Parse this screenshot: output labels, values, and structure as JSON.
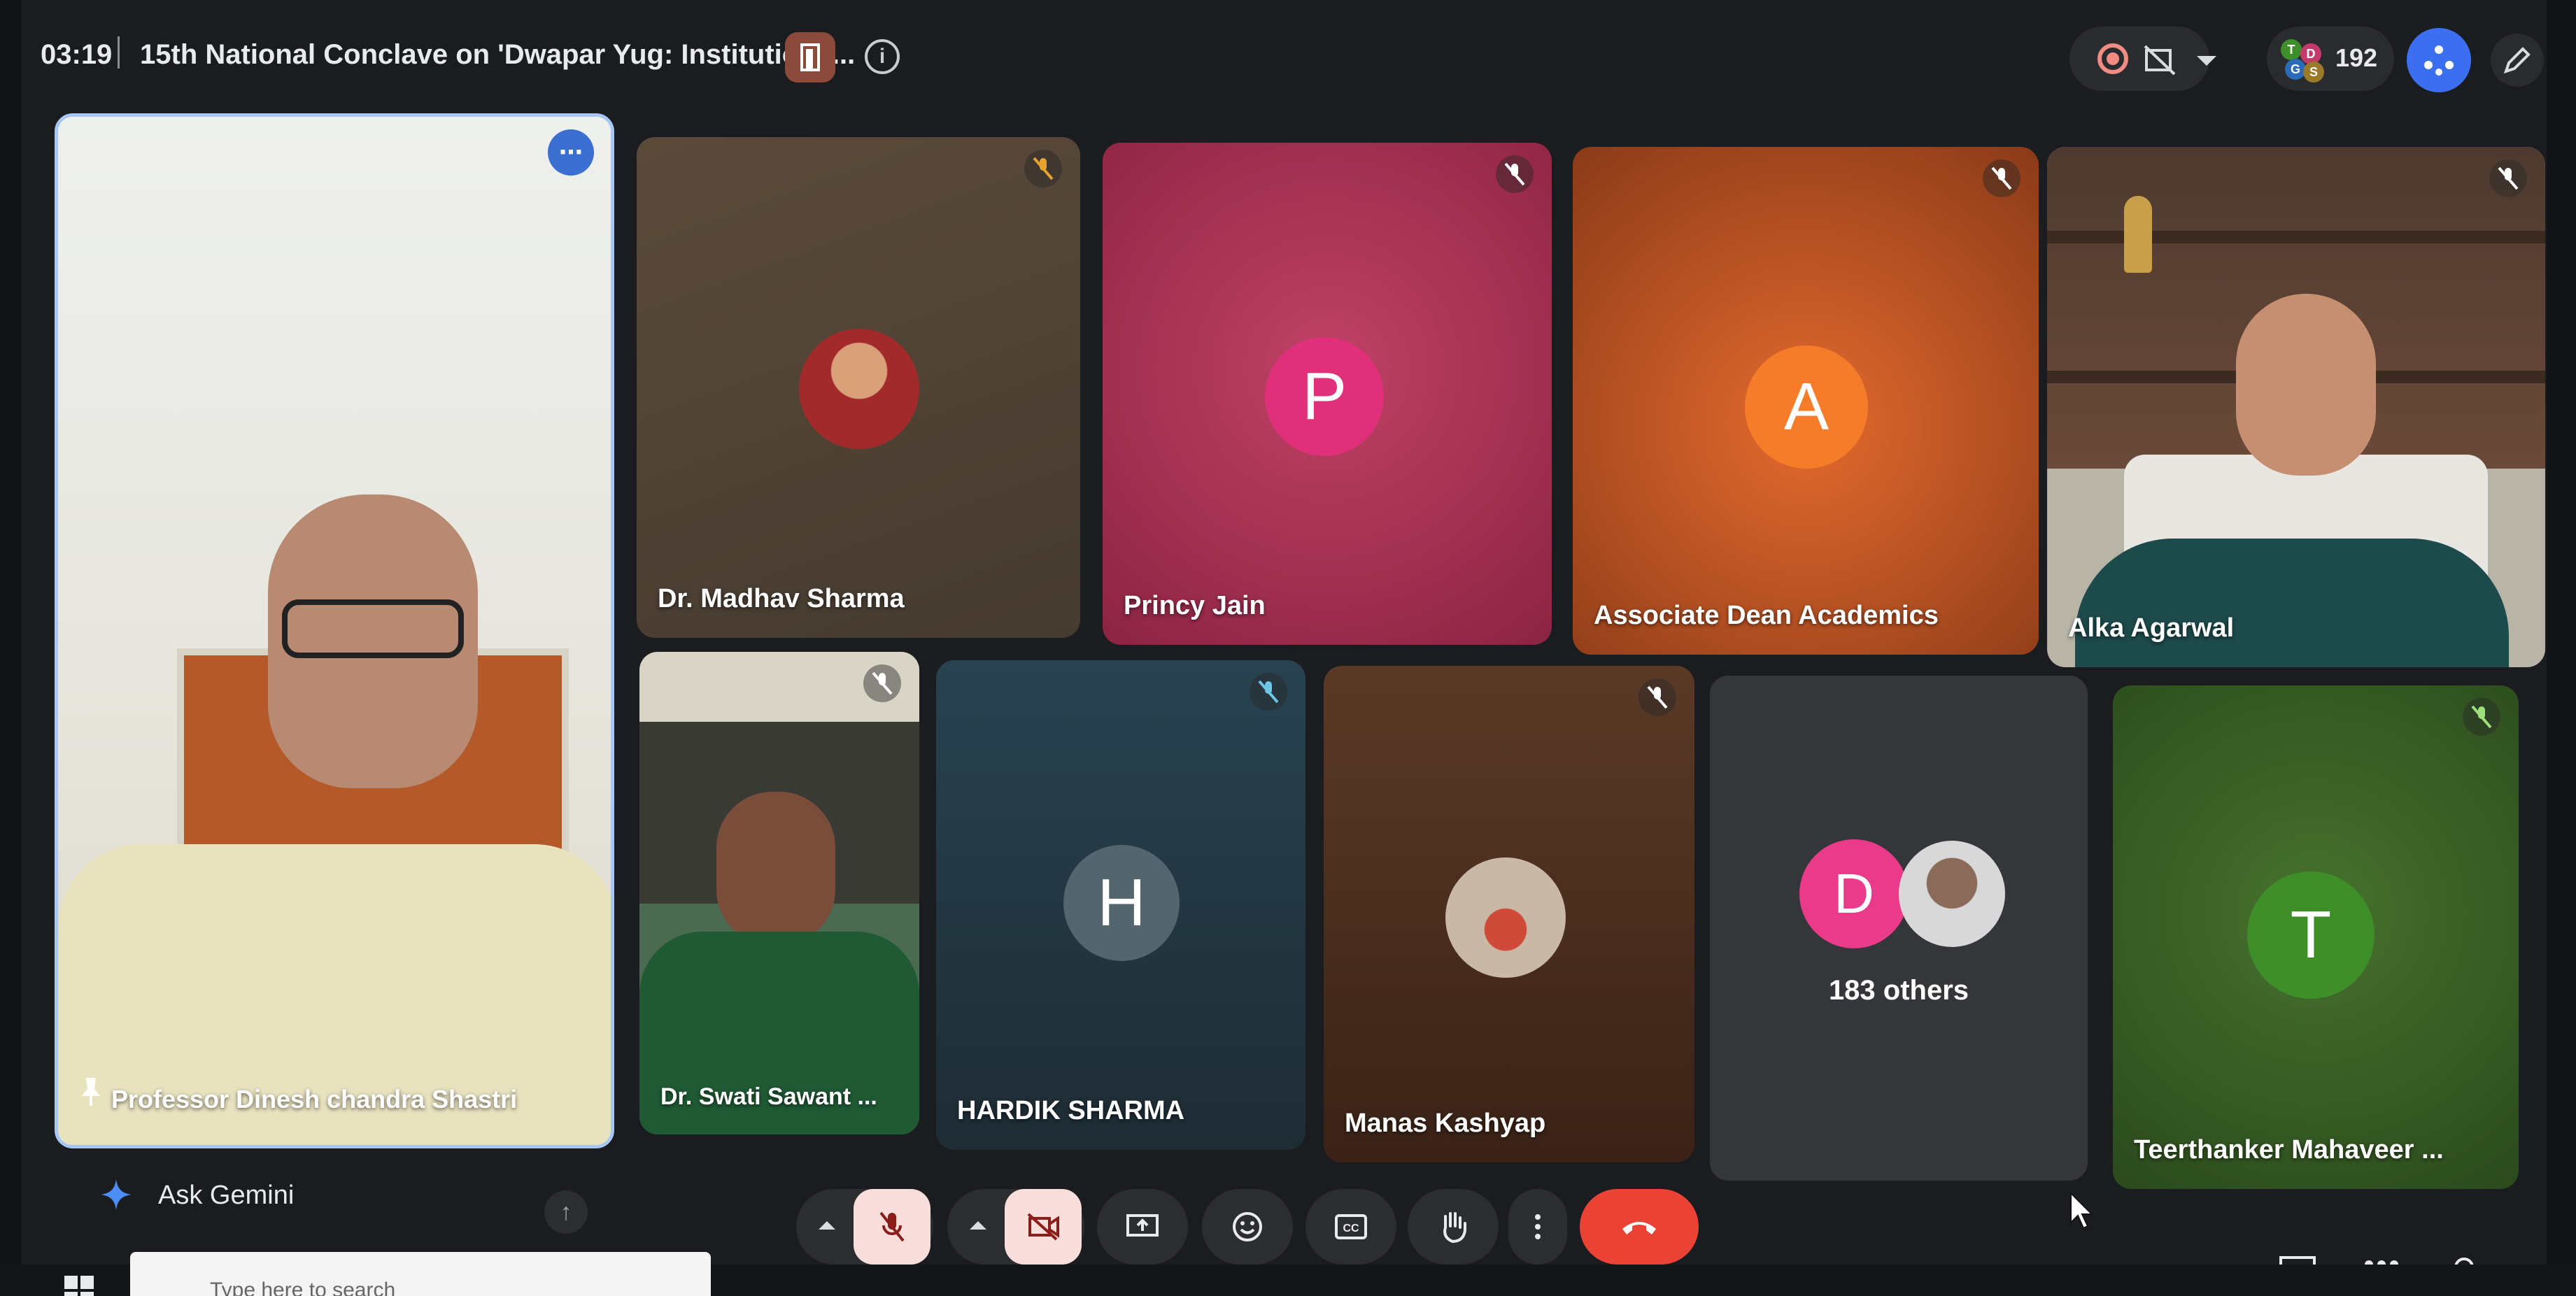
{
  "meeting": {
    "time": "03:19",
    "title": "15th National Conclave on 'Dwapar Yug: Institutiona...",
    "participant_count": "192"
  },
  "tiles": {
    "dinesh": {
      "name": "Professor Dinesh chandra Shastri"
    },
    "madhav": {
      "name": "Dr. Madhav Sharma"
    },
    "princy": {
      "name": "Princy Jain",
      "initial": "P",
      "color": "#e0307a"
    },
    "assoc": {
      "name": "Associate Dean Academics",
      "initial": "A",
      "color": "#f57c28"
    },
    "alka": {
      "name": "Alka Agarwal"
    },
    "swati": {
      "name": "Dr. Swati Sawant ..."
    },
    "hardik": {
      "name": "HARDIK SHARMA",
      "initial": "H",
      "color": "#55656e"
    },
    "manas": {
      "name": "Manas Kashyap"
    },
    "others": {
      "label": "183 others",
      "initial": "D",
      "color": "#ea3a8a"
    },
    "teer": {
      "name": "Teerthanker Mahaveer ...",
      "initial": "T",
      "color": "#3e8f2a"
    }
  },
  "gemini": {
    "label": "Ask Gemini"
  },
  "taskbar": {
    "search_placeholder": "Type here to search"
  }
}
